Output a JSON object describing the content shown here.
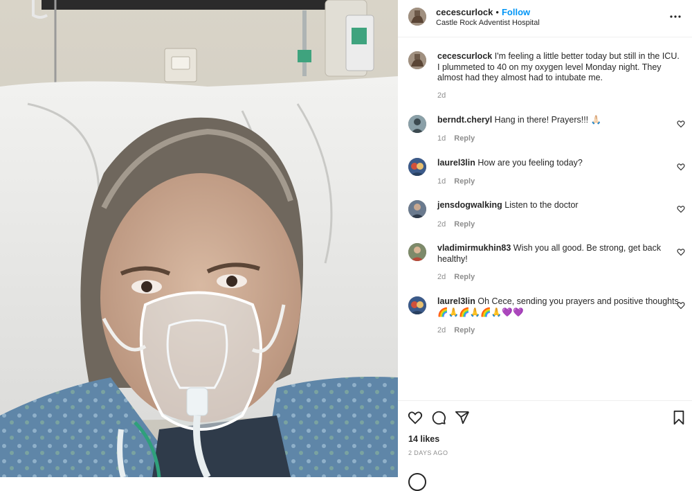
{
  "post": {
    "username": "cecescurlock",
    "separator": "•",
    "follow_label": "Follow",
    "location": "Castle Rock Adventist Hospital",
    "more_icon": "more-horizontal-icon",
    "caption": {
      "username": "cecescurlock",
      "text": "I'm feeling a little better today but still in the ICU. I plummeted to 40 on my oxygen level Monday night. They almost had they almost had to intubate me.",
      "time": "2d"
    }
  },
  "comments": [
    {
      "username": "berndt.cheryl",
      "text": "Hang in there! Prayers!!! 🙏🏻",
      "time": "1d",
      "reply_label": "Reply"
    },
    {
      "username": "laurel3lin",
      "text": "How are you feeling today?",
      "time": "1d",
      "reply_label": "Reply"
    },
    {
      "username": "jensdogwalking",
      "text": "Listen to the doctor",
      "time": "2d",
      "reply_label": "Reply"
    },
    {
      "username": "vladimirmukhin83",
      "text": "Wish you all good. Be strong, get back healthy!",
      "time": "2d",
      "reply_label": "Reply"
    },
    {
      "username": "laurel3lin",
      "text": "Oh Cece, sending you prayers and positive thoughts🌈🙏🌈🙏🌈🙏💜💜",
      "time": "2d",
      "reply_label": "Reply"
    }
  ],
  "actions": {
    "likes": "14 likes",
    "date": "2 DAYS AGO"
  },
  "colors": {
    "accent": "#0095f6",
    "muted": "#8e8e8e",
    "text": "#262626"
  }
}
